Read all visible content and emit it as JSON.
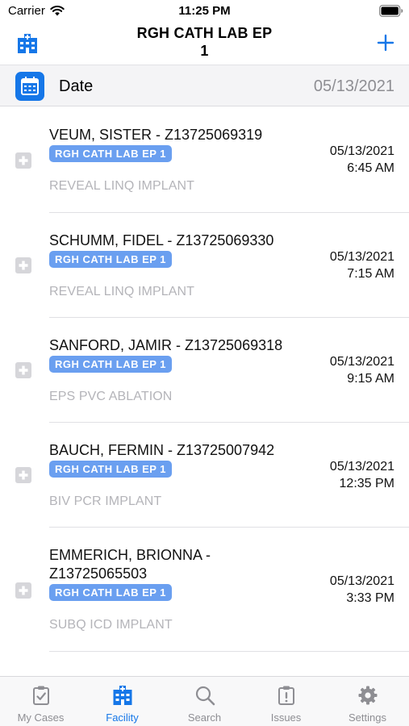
{
  "status_bar": {
    "carrier": "Carrier",
    "time": "11:25 PM"
  },
  "nav": {
    "title_line1": "RGH CATH LAB EP",
    "title_line2": "1",
    "left_icon": "hospital-icon",
    "right_icon": "plus-icon"
  },
  "date_row": {
    "label": "Date",
    "value": "05/13/2021",
    "icon": "calendar-icon"
  },
  "cases": [
    {
      "name": "VEUM, SISTER - Z13725069319",
      "badge": "RGH CATH LAB EP 1",
      "procedure": "REVEAL LINQ IMPLANT",
      "date": "05/13/2021",
      "time": "6:45 AM"
    },
    {
      "name": "SCHUMM, FIDEL - Z13725069330",
      "badge": "RGH CATH LAB EP 1",
      "procedure": "REVEAL LINQ IMPLANT",
      "date": "05/13/2021",
      "time": "7:15 AM"
    },
    {
      "name": "SANFORD, JAMIR - Z13725069318",
      "badge": "RGH CATH LAB EP 1",
      "procedure": "EPS PVC ABLATION",
      "date": "05/13/2021",
      "time": "9:15 AM"
    },
    {
      "name": "BAUCH, FERMIN - Z13725007942",
      "badge": "RGH CATH LAB EP 1",
      "procedure": "BIV PCR IMPLANT",
      "date": "05/13/2021",
      "time": "12:35 PM"
    },
    {
      "name_line1": "EMMERICH, BRIONNA -",
      "name_line2": "Z13725065503",
      "badge": "RGH CATH LAB EP 1",
      "procedure": "SUBQ ICD IMPLANT",
      "date": "05/13/2021",
      "time": "3:33 PM"
    }
  ],
  "tabs": [
    {
      "label": "My Cases",
      "icon": "clipboard-check-icon",
      "active": false
    },
    {
      "label": "Facility",
      "icon": "hospital-icon",
      "active": true
    },
    {
      "label": "Search",
      "icon": "search-icon",
      "active": false
    },
    {
      "label": "Issues",
      "icon": "alert-clipboard-icon",
      "active": false
    },
    {
      "label": "Settings",
      "icon": "gear-icon",
      "active": false
    }
  ],
  "colors": {
    "accent": "#1677e8",
    "badge": "#6a9ff0",
    "muted": "#8e8e93"
  }
}
